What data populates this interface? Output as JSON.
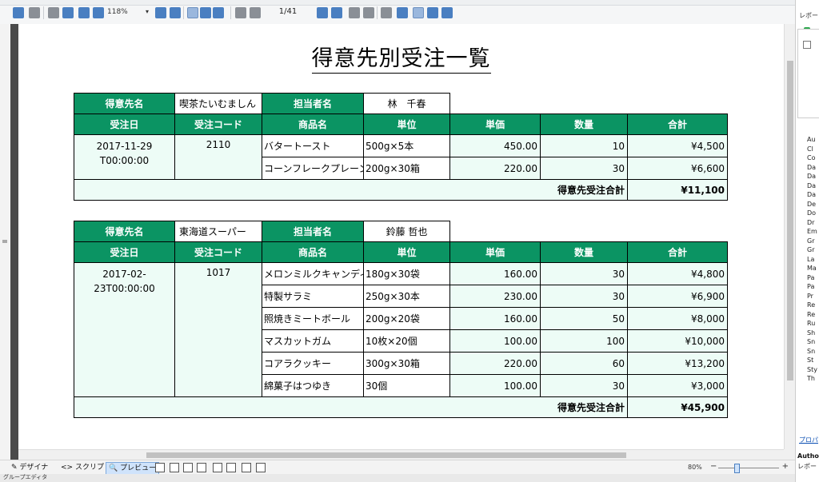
{
  "toolbar": {
    "zoom": "118%",
    "page_indicator": "1/41"
  },
  "report": {
    "title": "得意先別受注一覧",
    "headers": {
      "customer": "得意先名",
      "person": "担当者名",
      "order_date": "受注日",
      "order_code": "受注コード",
      "product": "商品名",
      "unit": "単位",
      "price": "単価",
      "qty": "数量",
      "total": "合計",
      "group_total_label": "得意先受注合計"
    },
    "groups": [
      {
        "customer": "喫茶たいむましん",
        "person": "林　千春",
        "order_date": "2017-11-29",
        "order_date_line2": "T00:00:00",
        "order_code": "2110",
        "items": [
          {
            "product": "バタートースト",
            "unit": "500g×5本",
            "price": "450.00",
            "qty": "10",
            "total": "¥4,500"
          },
          {
            "product": "コーンフレークプレーン",
            "unit": "200g×30箱",
            "price": "220.00",
            "qty": "30",
            "total": "¥6,600"
          }
        ],
        "group_total": "¥11,100"
      },
      {
        "customer": "東海道スーパー",
        "person": "鈴藤 哲也",
        "order_date": "2017-02-",
        "order_date_line2": "23T00:00:00",
        "order_code": "1017",
        "items": [
          {
            "product": "メロンミルクキャンディー",
            "unit": "180g×30袋",
            "price": "160.00",
            "qty": "30",
            "total": "¥4,800"
          },
          {
            "product": "特製サラミ",
            "unit": "250g×30本",
            "price": "230.00",
            "qty": "30",
            "total": "¥6,900"
          },
          {
            "product": "照焼きミートボール",
            "unit": "200g×20袋",
            "price": "160.00",
            "qty": "50",
            "total": "¥8,000"
          },
          {
            "product": "マスカットガム",
            "unit": "10枚×20個",
            "price": "100.00",
            "qty": "100",
            "total": "¥10,000"
          },
          {
            "product": "コアラクッキー",
            "unit": "300g×30箱",
            "price": "220.00",
            "qty": "60",
            "total": "¥13,200"
          },
          {
            "product": "綿菓子はつゆき",
            "unit": "30個",
            "price": "100.00",
            "qty": "30",
            "total": "¥3,000"
          }
        ],
        "group_total": "¥45,900"
      }
    ]
  },
  "bottom_tabs": {
    "design": "デザイナ",
    "script": "スクリプト",
    "preview": "プレビュー",
    "zoom": "80%"
  },
  "group_editor": "グループエディタ",
  "right_panel": {
    "title": "レポート",
    "props": [
      "Au",
      "Cl",
      "Co",
      "Da",
      "Da",
      "Da",
      "Da",
      "De",
      "Do",
      "Dr",
      "Em",
      "Gr",
      "Gr",
      "La",
      "Ma",
      "Pa",
      "Pa",
      "Pr",
      "Re",
      "Re",
      "Ru",
      "Sh",
      "Sn",
      "Sn",
      "St",
      "Sty",
      "Th"
    ],
    "link": "プロパ",
    "author_label": "Autho",
    "author_value": "レポー"
  }
}
